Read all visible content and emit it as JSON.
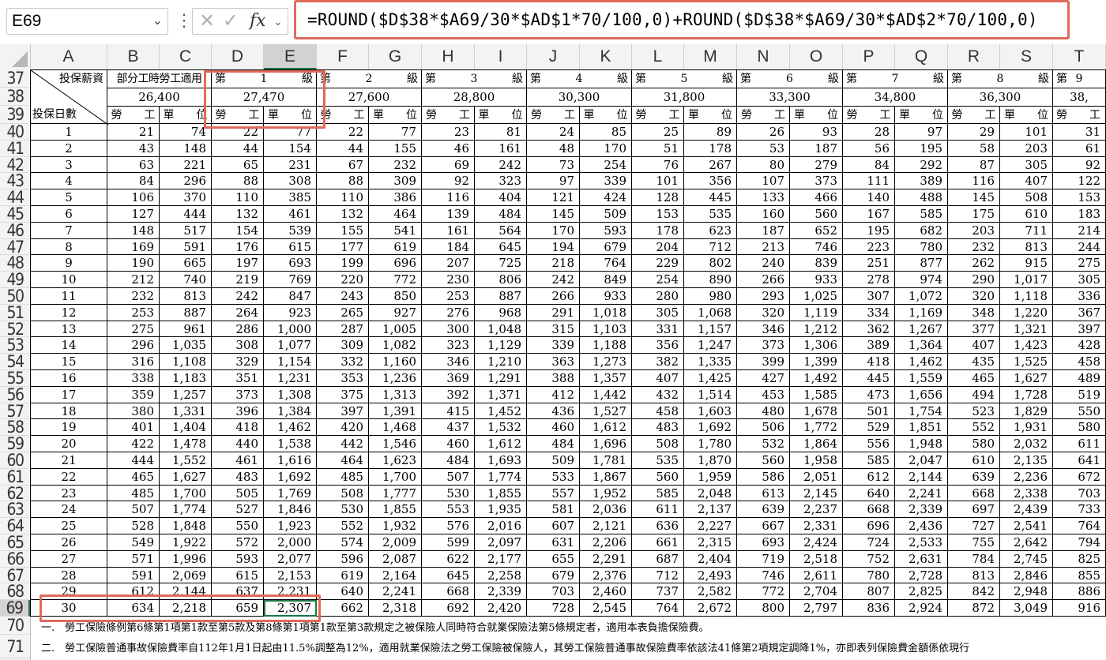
{
  "formula_bar": {
    "name_box": "E69",
    "fx_label": "fx",
    "formula": "=ROUND($D$38*$A69/30*$AD$1*70/100,0)+ROUND($D$38*$A69/30*$AD$2*70/100,0)"
  },
  "columns": [
    "A",
    "B",
    "C",
    "D",
    "E",
    "F",
    "G",
    "H",
    "I",
    "J",
    "K",
    "L",
    "M",
    "N",
    "O",
    "P",
    "Q",
    "R",
    "S",
    "T"
  ],
  "selected_column": "E",
  "selected_row": "69",
  "row_numbers": [
    "37",
    "38",
    "39",
    "40",
    "41",
    "42",
    "43",
    "44",
    "45",
    "46",
    "47",
    "48",
    "49",
    "50",
    "51",
    "52",
    "53",
    "54",
    "55",
    "56",
    "57",
    "58",
    "59",
    "60",
    "61",
    "62",
    "63",
    "64",
    "65",
    "66",
    "67",
    "68",
    "69",
    "70",
    "71"
  ],
  "header": {
    "diag_top": "投保薪資",
    "diag_bottom": "投保日數",
    "part_time_label": "部分工時勞工適用",
    "part_time_salary": "26,400",
    "grade_prefix": "第",
    "grade_suffix": "級",
    "grades": [
      "1",
      "2",
      "3",
      "4",
      "5",
      "6",
      "7",
      "8",
      "9"
    ],
    "salaries": [
      "27,470",
      "27,600",
      "28,800",
      "30,300",
      "31,800",
      "33,300",
      "34,800",
      "36,300",
      "38,"
    ],
    "labor_label": "勞　　工",
    "employer_label": "單　　位",
    "labor_cut": "勞",
    "employer_cut": "單"
  },
  "rows": [
    [
      "1",
      "21",
      "74",
      "22",
      "77",
      "22",
      "77",
      "23",
      "81",
      "24",
      "85",
      "25",
      "89",
      "26",
      "93",
      "28",
      "97",
      "29",
      "101",
      "31"
    ],
    [
      "2",
      "43",
      "148",
      "44",
      "154",
      "44",
      "155",
      "46",
      "161",
      "48",
      "170",
      "51",
      "178",
      "53",
      "187",
      "56",
      "195",
      "58",
      "203",
      "61"
    ],
    [
      "3",
      "63",
      "221",
      "65",
      "231",
      "67",
      "232",
      "69",
      "242",
      "73",
      "254",
      "76",
      "267",
      "80",
      "279",
      "84",
      "292",
      "87",
      "305",
      "92"
    ],
    [
      "4",
      "84",
      "296",
      "88",
      "308",
      "88",
      "309",
      "92",
      "323",
      "97",
      "339",
      "101",
      "356",
      "107",
      "373",
      "111",
      "389",
      "116",
      "407",
      "122"
    ],
    [
      "5",
      "106",
      "370",
      "110",
      "385",
      "110",
      "386",
      "116",
      "404",
      "121",
      "424",
      "128",
      "445",
      "133",
      "466",
      "140",
      "488",
      "145",
      "508",
      "153"
    ],
    [
      "6",
      "127",
      "444",
      "132",
      "461",
      "132",
      "464",
      "139",
      "484",
      "145",
      "509",
      "153",
      "535",
      "160",
      "560",
      "167",
      "585",
      "175",
      "610",
      "183"
    ],
    [
      "7",
      "148",
      "517",
      "154",
      "539",
      "155",
      "541",
      "161",
      "564",
      "170",
      "593",
      "178",
      "623",
      "187",
      "652",
      "195",
      "682",
      "203",
      "711",
      "214"
    ],
    [
      "8",
      "169",
      "591",
      "176",
      "615",
      "177",
      "619",
      "184",
      "645",
      "194",
      "679",
      "204",
      "712",
      "213",
      "746",
      "223",
      "780",
      "232",
      "813",
      "244"
    ],
    [
      "9",
      "190",
      "665",
      "197",
      "693",
      "199",
      "696",
      "207",
      "725",
      "218",
      "764",
      "229",
      "802",
      "240",
      "839",
      "251",
      "877",
      "262",
      "915",
      "275"
    ],
    [
      "10",
      "212",
      "740",
      "219",
      "769",
      "220",
      "772",
      "230",
      "806",
      "242",
      "849",
      "254",
      "890",
      "266",
      "933",
      "278",
      "974",
      "290",
      "1,017",
      "305"
    ],
    [
      "11",
      "232",
      "813",
      "242",
      "847",
      "243",
      "850",
      "253",
      "887",
      "266",
      "933",
      "280",
      "980",
      "293",
      "1,025",
      "307",
      "1,072",
      "320",
      "1,118",
      "336"
    ],
    [
      "12",
      "253",
      "887",
      "264",
      "923",
      "265",
      "927",
      "276",
      "968",
      "291",
      "1,018",
      "305",
      "1,068",
      "320",
      "1,119",
      "334",
      "1,169",
      "348",
      "1,220",
      "367"
    ],
    [
      "13",
      "275",
      "961",
      "286",
      "1,000",
      "287",
      "1,005",
      "300",
      "1,048",
      "315",
      "1,103",
      "331",
      "1,157",
      "346",
      "1,212",
      "362",
      "1,267",
      "377",
      "1,321",
      "397"
    ],
    [
      "14",
      "296",
      "1,035",
      "308",
      "1,077",
      "309",
      "1,082",
      "323",
      "1,129",
      "339",
      "1,188",
      "356",
      "1,247",
      "373",
      "1,306",
      "389",
      "1,364",
      "407",
      "1,423",
      "428"
    ],
    [
      "15",
      "316",
      "1,108",
      "329",
      "1,154",
      "332",
      "1,160",
      "346",
      "1,210",
      "363",
      "1,273",
      "382",
      "1,335",
      "399",
      "1,399",
      "418",
      "1,462",
      "435",
      "1,525",
      "458"
    ],
    [
      "16",
      "338",
      "1,183",
      "351",
      "1,231",
      "353",
      "1,236",
      "369",
      "1,291",
      "388",
      "1,357",
      "407",
      "1,425",
      "427",
      "1,492",
      "445",
      "1,559",
      "465",
      "1,627",
      "489"
    ],
    [
      "17",
      "359",
      "1,257",
      "373",
      "1,308",
      "375",
      "1,313",
      "392",
      "1,371",
      "412",
      "1,442",
      "432",
      "1,514",
      "453",
      "1,585",
      "473",
      "1,656",
      "494",
      "1,728",
      "519"
    ],
    [
      "18",
      "380",
      "1,331",
      "396",
      "1,384",
      "397",
      "1,391",
      "415",
      "1,452",
      "436",
      "1,527",
      "458",
      "1,603",
      "480",
      "1,678",
      "501",
      "1,754",
      "523",
      "1,829",
      "550"
    ],
    [
      "19",
      "401",
      "1,404",
      "418",
      "1,462",
      "420",
      "1,468",
      "437",
      "1,532",
      "460",
      "1,612",
      "483",
      "1,692",
      "506",
      "1,772",
      "529",
      "1,851",
      "552",
      "1,931",
      "580"
    ],
    [
      "20",
      "422",
      "1,478",
      "440",
      "1,538",
      "442",
      "1,546",
      "460",
      "1,612",
      "484",
      "1,696",
      "508",
      "1,780",
      "532",
      "1,864",
      "556",
      "1,948",
      "580",
      "2,032",
      "611"
    ],
    [
      "21",
      "444",
      "1,552",
      "461",
      "1,616",
      "464",
      "1,623",
      "484",
      "1,693",
      "509",
      "1,781",
      "535",
      "1,870",
      "560",
      "1,958",
      "585",
      "2,047",
      "610",
      "2,135",
      "641"
    ],
    [
      "22",
      "465",
      "1,627",
      "483",
      "1,692",
      "485",
      "1,700",
      "507",
      "1,774",
      "533",
      "1,867",
      "560",
      "1,959",
      "586",
      "2,051",
      "612",
      "2,144",
      "639",
      "2,236",
      "672"
    ],
    [
      "23",
      "485",
      "1,700",
      "505",
      "1,769",
      "508",
      "1,777",
      "530",
      "1,855",
      "557",
      "1,952",
      "585",
      "2,048",
      "613",
      "2,145",
      "640",
      "2,241",
      "668",
      "2,338",
      "703"
    ],
    [
      "24",
      "507",
      "1,774",
      "527",
      "1,846",
      "530",
      "1,855",
      "553",
      "1,935",
      "581",
      "2,036",
      "611",
      "2,137",
      "639",
      "2,237",
      "668",
      "2,339",
      "697",
      "2,439",
      "733"
    ],
    [
      "25",
      "528",
      "1,848",
      "550",
      "1,923",
      "552",
      "1,932",
      "576",
      "2,016",
      "607",
      "2,121",
      "636",
      "2,227",
      "667",
      "2,331",
      "696",
      "2,436",
      "727",
      "2,541",
      "764"
    ],
    [
      "26",
      "549",
      "1,922",
      "572",
      "2,000",
      "574",
      "2,009",
      "599",
      "2,097",
      "631",
      "2,206",
      "661",
      "2,315",
      "693",
      "2,424",
      "724",
      "2,533",
      "755",
      "2,642",
      "794"
    ],
    [
      "27",
      "571",
      "1,996",
      "593",
      "2,077",
      "596",
      "2,087",
      "622",
      "2,177",
      "655",
      "2,291",
      "687",
      "2,404",
      "719",
      "2,518",
      "752",
      "2,631",
      "784",
      "2,745",
      "825"
    ],
    [
      "28",
      "591",
      "2,069",
      "615",
      "2,153",
      "619",
      "2,164",
      "645",
      "2,258",
      "679",
      "2,376",
      "712",
      "2,493",
      "746",
      "2,611",
      "780",
      "2,728",
      "813",
      "2,846",
      "855"
    ],
    [
      "29",
      "612",
      "2,144",
      "637",
      "2,231",
      "640",
      "2,241",
      "668",
      "2,339",
      "703",
      "2,460",
      "737",
      "2,582",
      "772",
      "2,704",
      "807",
      "2,825",
      "842",
      "2,948",
      "886"
    ],
    [
      "30",
      "634",
      "2,218",
      "659",
      "2,307",
      "662",
      "2,318",
      "692",
      "2,420",
      "728",
      "2,545",
      "764",
      "2,672",
      "800",
      "2,797",
      "836",
      "2,924",
      "872",
      "3,049",
      "916"
    ]
  ],
  "notes": [
    "一.　勞工保險條例第6條第1項第1款至第5款及第8條第1項第1款至第3款規定之被保險人同時符合就業保險法第5條規定者，適用本表負擔保險費。",
    "二.　勞工保險普通事故保險費率自112年1月1日起由11.5%調整為12%，適用就業保險法之勞工保險被保險人，其勞工保險普通事故保險費率依該法41條第2項規定調降1%，亦即表列保險費金額係依現行"
  ],
  "colors": {
    "highlight": "#e06a5a",
    "selection": "#217346",
    "header_bg": "#f3f3f3"
  }
}
